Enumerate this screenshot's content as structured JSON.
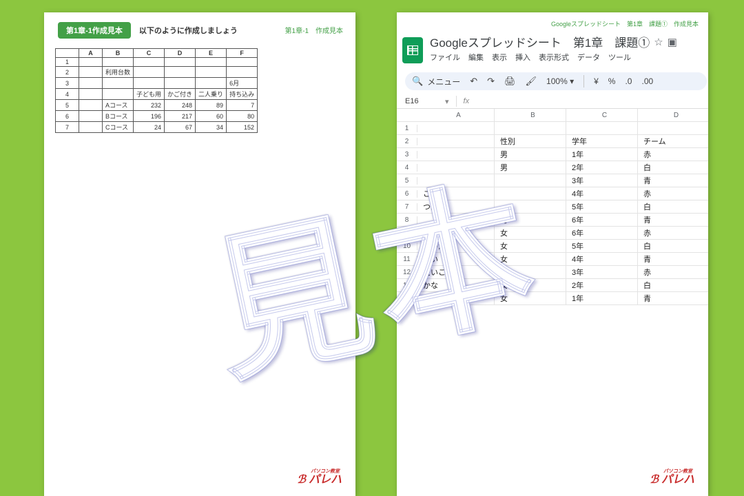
{
  "left": {
    "badge": "第1章-1作成見本",
    "instruction": "以下のように作成しましょう",
    "topright": "第1章-1　作成見本",
    "cols": [
      "",
      "A",
      "B",
      "C",
      "D",
      "E",
      "F"
    ],
    "rows": [
      {
        "n": "1",
        "cells": [
          "",
          "",
          "",
          "",
          "",
          ""
        ]
      },
      {
        "n": "2",
        "cells": [
          "",
          "利用台数",
          "",
          "",
          "",
          ""
        ]
      },
      {
        "n": "3",
        "cells": [
          "",
          "",
          "",
          "",
          "",
          "6月"
        ]
      },
      {
        "n": "4",
        "cells": [
          "",
          "",
          "子ども用",
          "かご付き",
          "二人乗り",
          "持ち込み"
        ]
      },
      {
        "n": "5",
        "cells": [
          "",
          "Aコース",
          "232",
          "248",
          "89",
          "7"
        ]
      },
      {
        "n": "6",
        "cells": [
          "",
          "Bコース",
          "196",
          "217",
          "60",
          "80"
        ]
      },
      {
        "n": "7",
        "cells": [
          "",
          "Cコース",
          "24",
          "67",
          "34",
          "152"
        ]
      }
    ]
  },
  "right": {
    "topright": "Googleスプレッドシート　第1章　課題①　作成見本",
    "title": "Googleスプレッドシート　第1章　課題①",
    "menus": [
      "ファイル",
      "編集",
      "表示",
      "挿入",
      "表示形式",
      "データ",
      "ツール"
    ],
    "toolbar": {
      "search_label": "メニュー",
      "zoom": "100%",
      "currency": "¥",
      "percent": "%",
      "dec_dec": ".0",
      "dec_inc": ".00"
    },
    "namebox": "E16",
    "cols": [
      "A",
      "B",
      "C",
      "D"
    ],
    "data": [
      {
        "n": "1",
        "a": "",
        "b": "",
        "c": "",
        "d": ""
      },
      {
        "n": "2",
        "a": "",
        "b": "性別",
        "c": "学年",
        "d": "チーム"
      },
      {
        "n": "3",
        "a": "",
        "b": "男",
        "c": "1年",
        "d": "赤"
      },
      {
        "n": "4",
        "a": "",
        "b": "男",
        "c": "2年",
        "d": "白"
      },
      {
        "n": "5",
        "a": "",
        "b": "",
        "c": "3年",
        "d": "青"
      },
      {
        "n": "6",
        "a": "こう",
        "b": "",
        "c": "4年",
        "d": "赤"
      },
      {
        "n": "7",
        "a": "つば",
        "b": "",
        "c": "5年",
        "d": "白"
      },
      {
        "n": "8",
        "a": "",
        "b": "男",
        "c": "6年",
        "d": "青"
      },
      {
        "n": "9",
        "a": "",
        "b": "女",
        "c": "6年",
        "d": "赤"
      },
      {
        "n": "10",
        "a": "まゆか",
        "b": "女",
        "c": "5年",
        "d": "白"
      },
      {
        "n": "11",
        "a": "あい",
        "b": "女",
        "c": "4年",
        "d": "青"
      },
      {
        "n": "12",
        "a": "えいこ",
        "b": "女",
        "c": "3年",
        "d": "赤"
      },
      {
        "n": "13",
        "a": "かな",
        "b": "女",
        "c": "2年",
        "d": "白"
      },
      {
        "n": "14",
        "a": "なつき",
        "b": "女",
        "c": "1年",
        "d": "青"
      }
    ]
  },
  "brand": {
    "small": "パソコン教室",
    "big": "パレハ"
  },
  "watermark": "見本"
}
